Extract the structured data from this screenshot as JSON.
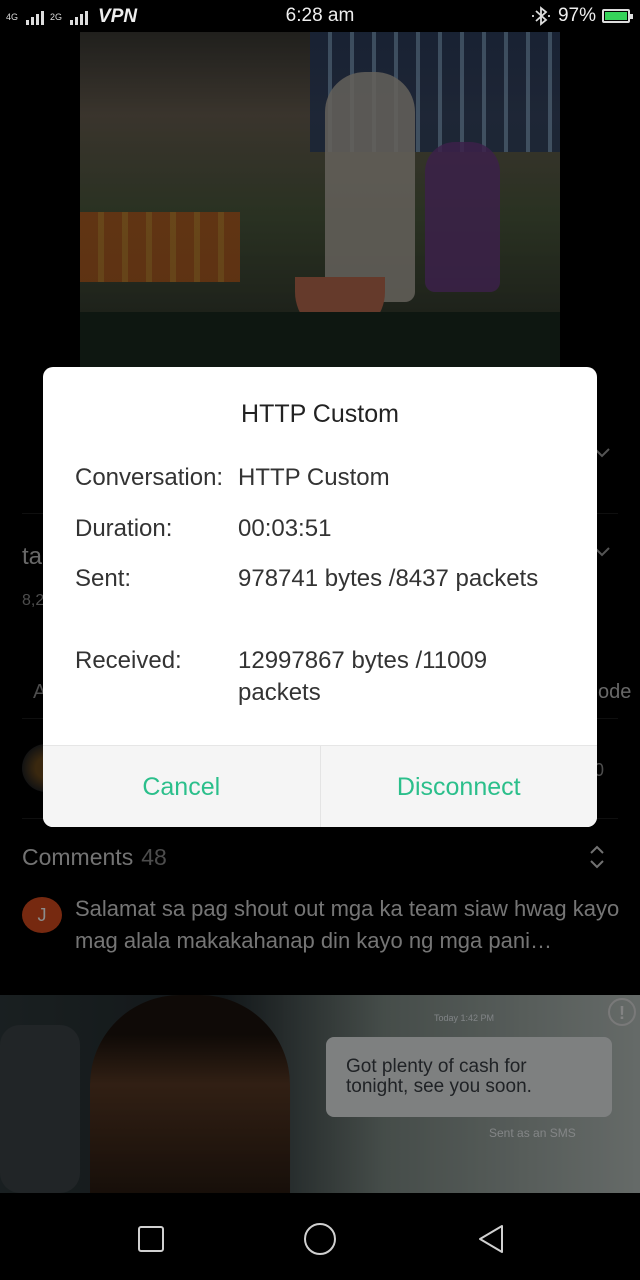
{
  "status_bar": {
    "network_1": "4G",
    "network_2": "2G",
    "vpn": "VPN",
    "time": "6:28 am",
    "battery": "97%"
  },
  "background": {
    "title_fragment": "ta",
    "views_fragment": "8,2",
    "tab_fragment_left": "A",
    "tab_fragment_right": "ode",
    "count_fragment": "0",
    "comments_label": "Comments",
    "comments_count": "48",
    "comment": {
      "avatar_initial": "J",
      "text": "Salamat sa pag shout out mga ka team siaw hwag kayo mag alala makakahanap din kayo ng mga pani…"
    }
  },
  "ad": {
    "timestamp": "Today 1:42 PM",
    "message": "Got plenty of cash for tonight, see you soon.",
    "sent_label": "Sent as an SMS",
    "info_glyph": "!"
  },
  "dialog": {
    "title": "HTTP Custom",
    "rows": [
      {
        "label": "Conversation:",
        "value": "HTTP Custom"
      },
      {
        "label": "Duration:",
        "value": "00:03:51"
      },
      {
        "label": "Sent:",
        "value": "978741 bytes /8437 packets"
      },
      {
        "label": "Received:",
        "value": "12997867 bytes /11009 packets"
      }
    ],
    "cancel_label": "Cancel",
    "disconnect_label": "Disconnect"
  },
  "colors": {
    "accent": "#2bbf8b",
    "battery": "#36d35a",
    "avatar": "#d84b1e"
  },
  "icons": [
    "bluetooth-icon",
    "battery-icon",
    "chevron-down-icon",
    "sort-icon",
    "info-icon",
    "recents-icon",
    "home-icon",
    "back-icon"
  ]
}
